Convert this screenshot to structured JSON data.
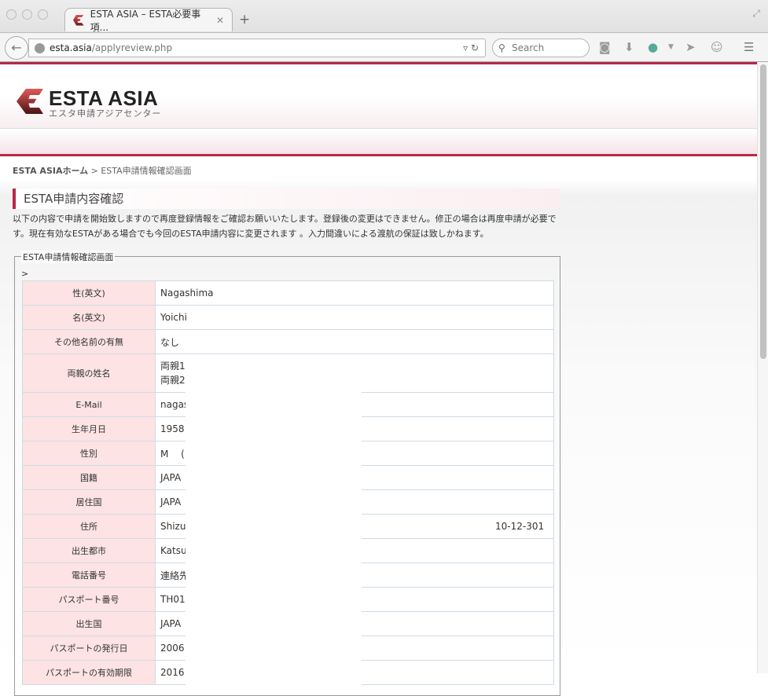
{
  "browser": {
    "tab_title": "ESTA ASIA – ESTA必要事項...",
    "url_domain": "esta.asia",
    "url_path": "/applyreview.php",
    "search_placeholder": "Search"
  },
  "site": {
    "logo_text": "ESTA ASIA",
    "logo_sub": "エスタ申請アジアセンター",
    "accent": "#b8284a"
  },
  "breadcrumb": {
    "home": "ESTA ASIAホーム",
    "sep": " > ",
    "current": "ESTA申請情報確認画面"
  },
  "heading": "ESTA申請内容確認",
  "intro": "以下の内容で申請を開始致しますので再度登録情報をご確認お願いいたします。登録後の変更はできません。修正の場合は再度申請が必要です。現在有効なESTAがある場合でも今回のESTA申請内容に変更されます 。入力間違いによる渡航の保証は致しかねます。",
  "fieldset": {
    "legend": "ESTA申請情報確認画面",
    "stray": ">"
  },
  "rows": [
    {
      "label": "性(英文)",
      "value": "Nagashima"
    },
    {
      "label": "名(英文)",
      "value": "Yoichi"
    },
    {
      "label": "その他名前の有無",
      "value": "なし"
    },
    {
      "label": "両親の姓名",
      "value": "両親1",
      "value2": "両親2"
    },
    {
      "label": "E-Mail",
      "value": "nagas"
    },
    {
      "label": "生年月日",
      "value": "1958"
    },
    {
      "label": "性別",
      "value": "M　 ("
    },
    {
      "label": "国籍",
      "value": "JAPA"
    },
    {
      "label": "居住国",
      "value": "JAPA"
    },
    {
      "label": "住所",
      "value": "Shizu",
      "value_right": "10-12-301"
    },
    {
      "label": "出生都市",
      "value": "Katsu"
    },
    {
      "label": "電話番号",
      "value": "連絡先"
    },
    {
      "label": "パスポート番号",
      "value": "TH01"
    },
    {
      "label": "出生国",
      "value": "JAPA"
    },
    {
      "label": "パスポートの発行日",
      "value": "2006"
    },
    {
      "label": "パスポートの有効期限",
      "value": "2016"
    }
  ]
}
